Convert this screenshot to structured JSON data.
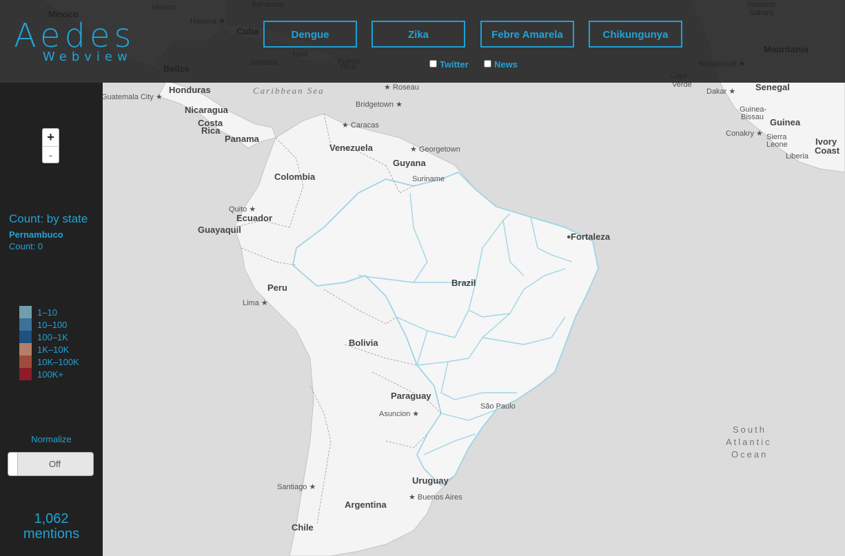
{
  "app": {
    "logo_main": "Aedes",
    "logo_sub": "Webview"
  },
  "diseases": [
    {
      "label": "Dengue"
    },
    {
      "label": "Zika"
    },
    {
      "label": "Febre Amarela"
    },
    {
      "label": "Chikungunya"
    }
  ],
  "sources": {
    "twitter_label": "Twitter",
    "twitter_checked": false,
    "news_label": "News",
    "news_checked": false
  },
  "zoom": {
    "in_label": "+",
    "out_label": "-"
  },
  "info": {
    "title": "Count: by state",
    "state": "Pernambuco",
    "count": "Count: 0"
  },
  "legend": [
    {
      "label": "1–10",
      "color": "#6f9fac"
    },
    {
      "label": "10–100",
      "color": "#3a7397"
    },
    {
      "label": "100–1K",
      "color": "#1e5080"
    },
    {
      "label": "1K–10K",
      "color": "#b57e67"
    },
    {
      "label": "10K–100K",
      "color": "#9e4b3d"
    },
    {
      "label": "100K+",
      "color": "#8c1c28"
    }
  ],
  "normalize": {
    "label": "Normalize",
    "state": "Off"
  },
  "mentions": {
    "count": "1,062",
    "label": "mentions"
  },
  "map": {
    "accent_border": "#9fd4e8",
    "labels": {
      "countries": [
        "Mexico",
        "Cuba",
        "Honduras",
        "Nicaragua",
        "Costa Rica",
        "Panama",
        "Venezuela",
        "Colombia",
        "Guyana",
        "Suriname",
        "Ecuador",
        "Peru",
        "Brazil",
        "Bolivia",
        "Paraguay",
        "Uruguay",
        "Argentina",
        "Chile",
        "Belize",
        "Haiti",
        "Jamaica",
        "Puerto Rico",
        "Bahamas",
        "Western Sahara",
        "Mauritania",
        "Senegal",
        "Guinea-Bissau",
        "Guinea",
        "Sierra Leone",
        "Liberia",
        "Ivory Coast",
        "Cape Verde"
      ],
      "cities": [
        "Havana",
        "Mexico",
        "Guatemala City",
        "Caracas",
        "Bridgetown",
        "Roseau",
        "Georgetown",
        "Quito",
        "Guayaquil",
        "Lima",
        "Fortaleza",
        "São Paulo",
        "Asuncion",
        "Santiago",
        "Buenos Aires",
        "Nouakchott",
        "Dakar",
        "Conakry"
      ],
      "seas": [
        "Caribbean Sea"
      ],
      "ocean_lines": [
        "South",
        "Atlantic",
        "Ocean"
      ]
    }
  }
}
